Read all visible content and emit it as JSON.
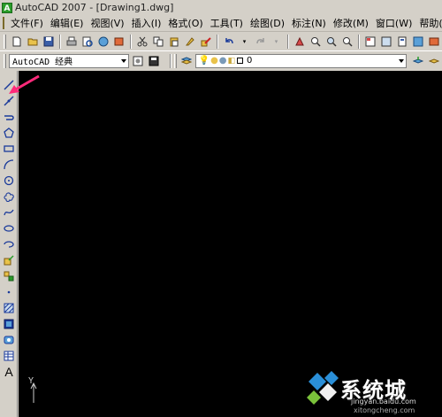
{
  "window": {
    "title": "AutoCAD 2007 - [Drawing1.dwg]"
  },
  "menu": {
    "items": [
      "文件(F)",
      "编辑(E)",
      "视图(V)",
      "插入(I)",
      "格式(O)",
      "工具(T)",
      "绘图(D)",
      "标注(N)",
      "修改(M)",
      "窗口(W)",
      "帮助(H)"
    ]
  },
  "workspace": {
    "value": "AutoCAD 经典",
    "layer_value": "0"
  },
  "canvas": {
    "ucs_label": "Y",
    "background": "#000000"
  },
  "draw_tools": [
    "line-icon",
    "construction-line-icon",
    "polyline-icon",
    "polygon-icon",
    "rectangle-icon",
    "arc-icon",
    "circle-icon",
    "revision-cloud-icon",
    "spline-icon",
    "ellipse-icon",
    "ellipse-arc-icon",
    "insert-block-icon",
    "make-block-icon",
    "point-icon",
    "hatch-icon",
    "gradient-icon",
    "region-icon",
    "table-icon",
    "multiline-text-icon"
  ],
  "draw_tool_text": "A",
  "watermark": {
    "text": "系统城",
    "line1": "jingyan.baidu.com",
    "line2": "xitongcheng.com"
  },
  "colors": {
    "accent": "#2a8fd8",
    "annotation": "#ff2a7a"
  }
}
